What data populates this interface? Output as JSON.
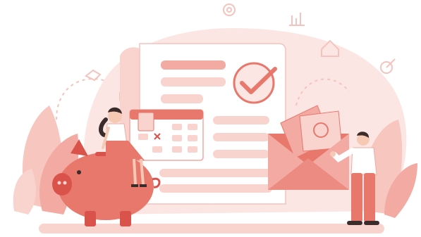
{
  "illustration": {
    "kind": "flat vector illustration",
    "palette": {
      "blob": "#fbe6e3",
      "light": "#f9d3ce",
      "mid": "#f2aaa2",
      "accent": "#e8776c",
      "dark": "#d9534a",
      "paper": "#ffffff",
      "hair": "#3b2b2b",
      "skin": "#f6c9b5",
      "trousers": "#e8776c"
    },
    "icons": [
      "piggy-bank-icon",
      "document-icon",
      "checkmark-icon",
      "calendar-icon",
      "envelope-icon",
      "cash-icon",
      "gear-icon",
      "chart-icon",
      "wallet-icon",
      "house-icon",
      "handshake-icon",
      "target-icon"
    ]
  }
}
